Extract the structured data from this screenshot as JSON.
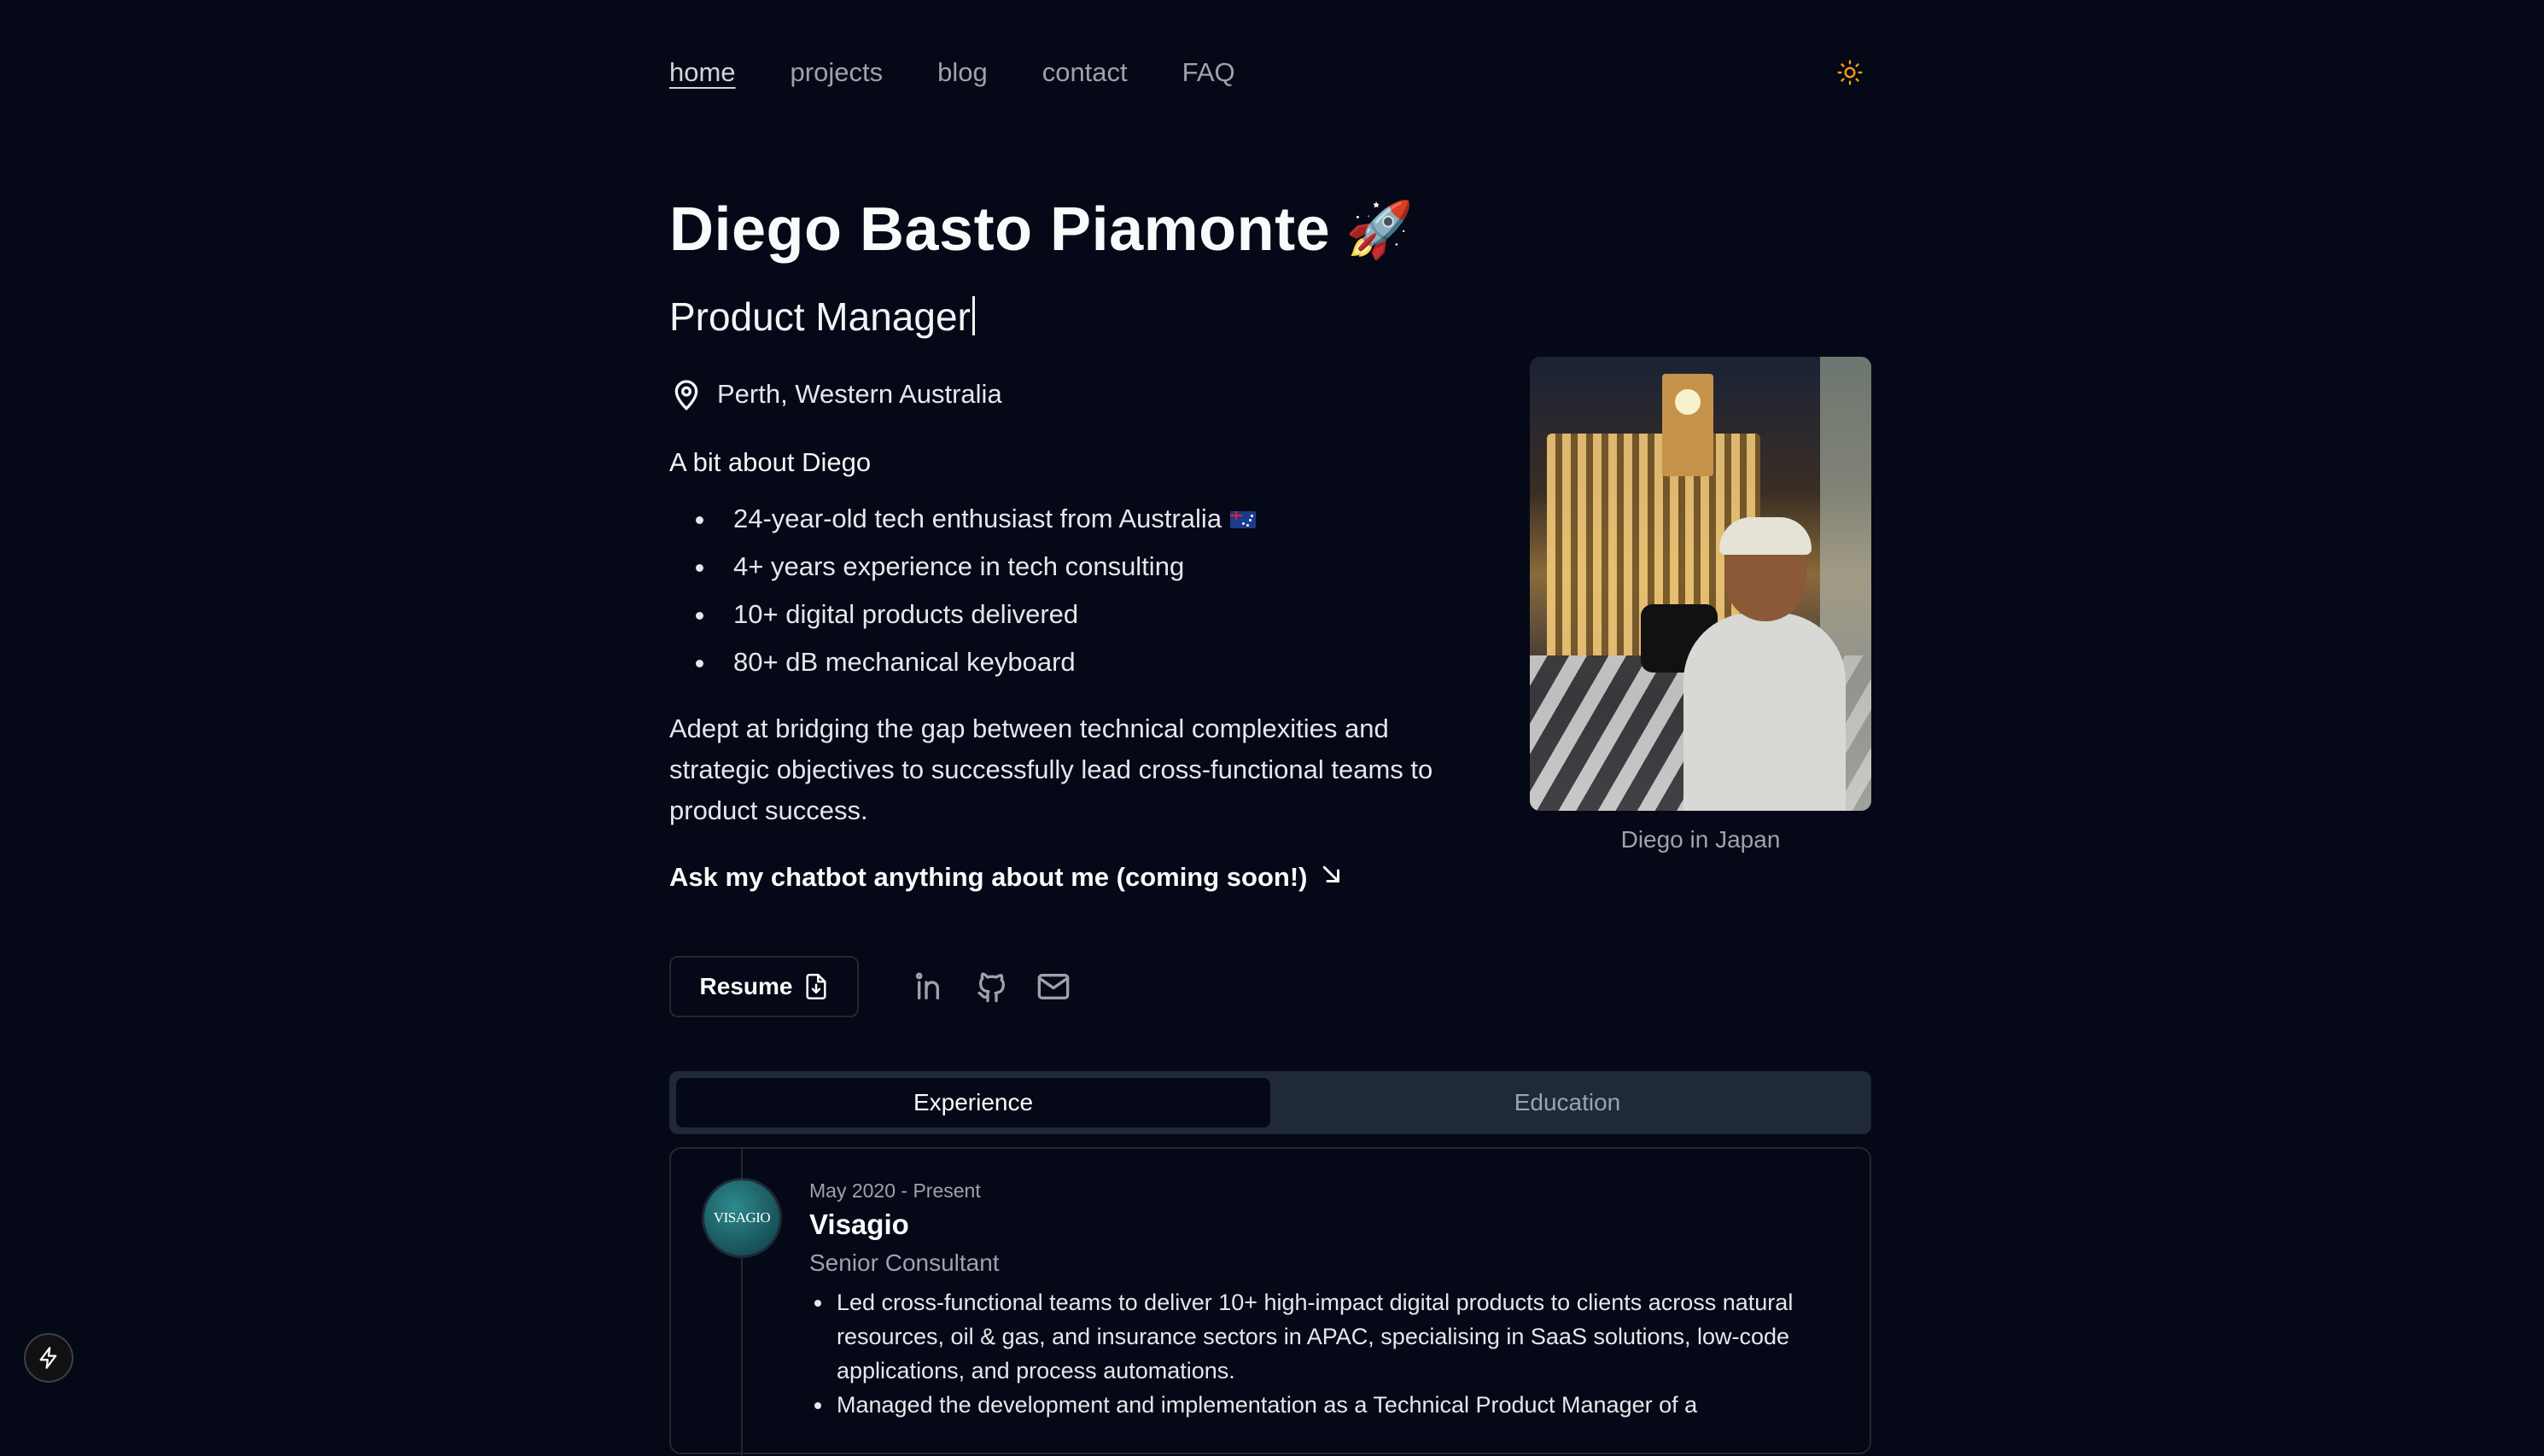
{
  "nav": {
    "items": [
      {
        "label": "home",
        "active": true
      },
      {
        "label": "projects",
        "active": false
      },
      {
        "label": "blog",
        "active": false
      },
      {
        "label": "contact",
        "active": false
      },
      {
        "label": "FAQ",
        "active": false
      }
    ],
    "theme_icon": "sun-icon"
  },
  "hero": {
    "name": "Diego Basto Piamonte",
    "emoji": "🚀",
    "role": "Product Manager",
    "location": "Perth, Western Australia",
    "about_title": "A bit about Diego",
    "bullets": [
      "24-year-old tech enthusiast from Australia",
      "4+ years experience in tech consulting",
      "10+ digital products delivered",
      "80+ dB mechanical keyboard"
    ],
    "summary": "Adept at bridging the gap between technical complexities and strategic objectives to successfully lead cross-functional teams to product success.",
    "chatbot_link": "Ask my chatbot anything about me (coming soon!)"
  },
  "photo": {
    "caption": "Diego in Japan"
  },
  "actions": {
    "resume_label": "Resume",
    "socials": [
      "linkedin-icon",
      "github-icon",
      "mail-icon"
    ]
  },
  "tabs": [
    {
      "label": "Experience",
      "active": true
    },
    {
      "label": "Education",
      "active": false
    }
  ],
  "experience": [
    {
      "logo_text": "VISAGIO",
      "date": "May 2020 - Present",
      "company": "Visagio",
      "title": "Senior Consultant",
      "points": [
        "Led cross-functional teams to deliver 10+ high-impact digital products to clients across natural resources, oil & gas, and insurance sectors in APAC, specialising in SaaS solutions, low-code applications, and process automations.",
        "Managed the development and implementation as a Technical Product Manager of a"
      ]
    }
  ],
  "colors": {
    "background": "#050816",
    "accent_sun": "#f59e0b",
    "muted_text": "#a1a1aa"
  }
}
